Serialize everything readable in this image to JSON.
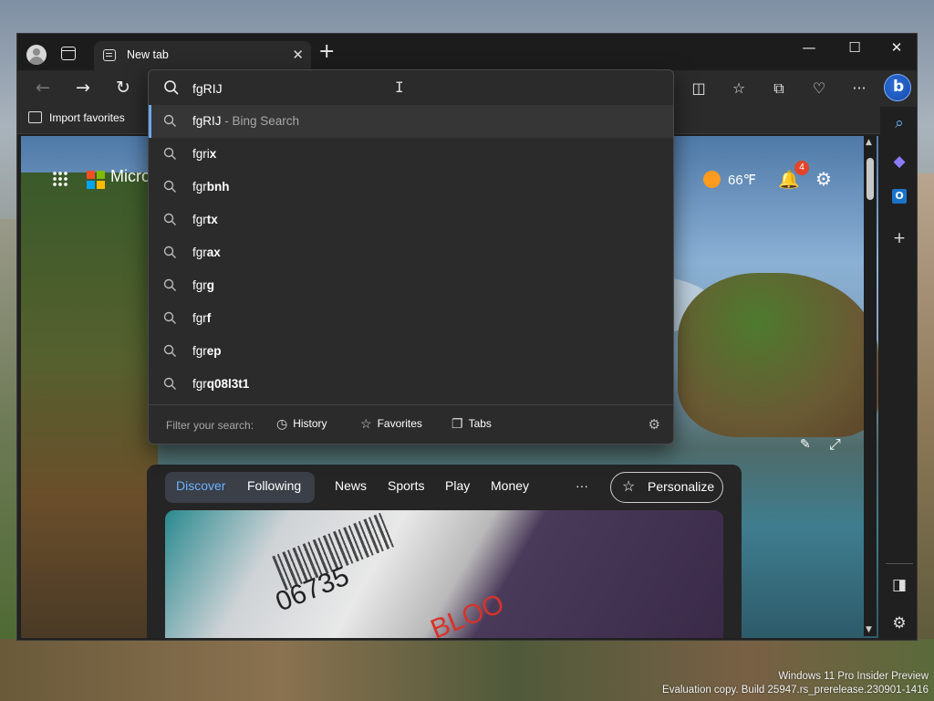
{
  "browser": {
    "tab_title": "New tab",
    "tab_close": "✕",
    "new_tab": "+",
    "window_controls": {
      "minimize": "—",
      "maximize": "☐",
      "close": "✕"
    },
    "nav": {
      "back": "←",
      "forward": "→",
      "refresh": "↻"
    },
    "toolbar_icons": [
      "split-screen-icon",
      "favorites-icon",
      "collections-icon",
      "browser-essentials-icon",
      "more-icon"
    ],
    "toolbar_glyphs": {
      "split": "◫",
      "favorites": "☆",
      "collections": "⧉",
      "essentials": "♡",
      "more": "···"
    },
    "bing_glyph": "b",
    "favorites_bar": {
      "import": "Import favorites"
    }
  },
  "address": {
    "value": "fgRIJ",
    "suggestions": [
      {
        "prefix": "fgRIJ",
        "suffix": "",
        "sub": " - Bing Search"
      },
      {
        "prefix": "fgri",
        "suffix": "x"
      },
      {
        "prefix": "fgr",
        "suffix": "bnh"
      },
      {
        "prefix": "fgr",
        "suffix": "tx"
      },
      {
        "prefix": "fgr",
        "suffix": "ax"
      },
      {
        "prefix": "fgr",
        "suffix": "g"
      },
      {
        "prefix": "fgr",
        "suffix": "f"
      },
      {
        "prefix": "fgr",
        "suffix": "ep"
      },
      {
        "prefix": "fgr",
        "suffix": "q08l3t1"
      }
    ],
    "filter": {
      "label": "Filter your search:",
      "history": "History",
      "favorites": "Favorites",
      "tabs": "Tabs"
    }
  },
  "newtab": {
    "brand": "Micro",
    "weather": "66℉",
    "notifications": "4",
    "feed_tabs": {
      "discover": "Discover",
      "following": "Following",
      "news": "News",
      "sports": "Sports",
      "play": "Play",
      "money": "Money",
      "more": "···"
    },
    "personalize": "Personalize",
    "card_number": "06735",
    "card_word": "BLOO"
  },
  "sidebar": {
    "search": "⌕",
    "add": "+",
    "gear": "⚙"
  },
  "desktop": {
    "watermark_line1": "Windows 11 Pro Insider Preview",
    "watermark_line2": "Evaluation copy. Build 25947.rs_prerelease.230901-1416"
  },
  "colors": {
    "accent": "#6db3ff",
    "dropdown_bg": "#2b2b2b",
    "selected_bar": "#6ba9e8"
  }
}
